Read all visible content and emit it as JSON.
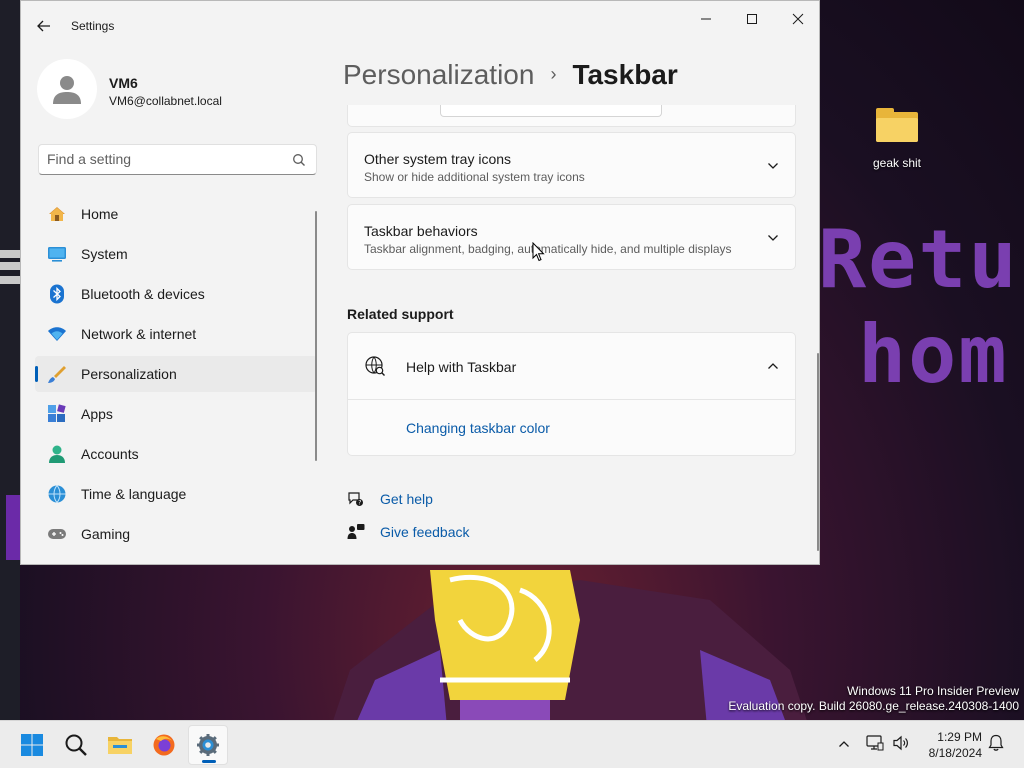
{
  "window": {
    "title": "Settings",
    "controls": {
      "minimize": "minimize",
      "maximize": "maximize",
      "close": "close"
    }
  },
  "profile": {
    "name": "VM6",
    "email": "VM6@collabnet.local"
  },
  "search": {
    "placeholder": "Find a setting"
  },
  "nav": {
    "items": [
      {
        "label": "Home",
        "icon": "home-icon"
      },
      {
        "label": "System",
        "icon": "system-icon"
      },
      {
        "label": "Bluetooth & devices",
        "icon": "bluetooth-icon"
      },
      {
        "label": "Network & internet",
        "icon": "wifi-icon"
      },
      {
        "label": "Personalization",
        "icon": "paintbrush-icon",
        "active": true
      },
      {
        "label": "Apps",
        "icon": "apps-icon"
      },
      {
        "label": "Accounts",
        "icon": "accounts-icon"
      },
      {
        "label": "Time & language",
        "icon": "globe-clock-icon"
      },
      {
        "label": "Gaming",
        "icon": "gamepad-icon"
      }
    ]
  },
  "breadcrumb": {
    "parent": "Personalization",
    "separator": "›",
    "current": "Taskbar"
  },
  "cards": {
    "other_tray": {
      "title": "Other system tray icons",
      "subtitle": "Show or hide additional system tray icons"
    },
    "behaviors": {
      "title": "Taskbar behaviors",
      "subtitle": "Taskbar alignment, badging, automatically hide, and multiple displays"
    }
  },
  "related_support": {
    "heading": "Related support",
    "help": {
      "title": "Help with Taskbar",
      "link": "Changing taskbar color"
    }
  },
  "bottom_links": {
    "get_help": "Get help",
    "feedback": "Give feedback"
  },
  "desktop": {
    "icon_label": "geak shit",
    "retro_text_1": "Retur",
    "retro_text_2": "hom",
    "watermark_line1": "Windows 11 Pro Insider Preview",
    "watermark_line2": "Evaluation copy. Build 26080.ge_release.240308-1400"
  },
  "taskbar": {
    "apps": [
      "start-icon",
      "search-icon",
      "file-explorer-icon",
      "firefox-icon",
      "settings-icon"
    ],
    "time": "1:29 PM",
    "date": "8/18/2024"
  },
  "colors": {
    "accent": "#005fb8",
    "link": "#0a5ba8",
    "window_bg": "#f3f3f3",
    "card_bg": "#fbfbfb"
  }
}
